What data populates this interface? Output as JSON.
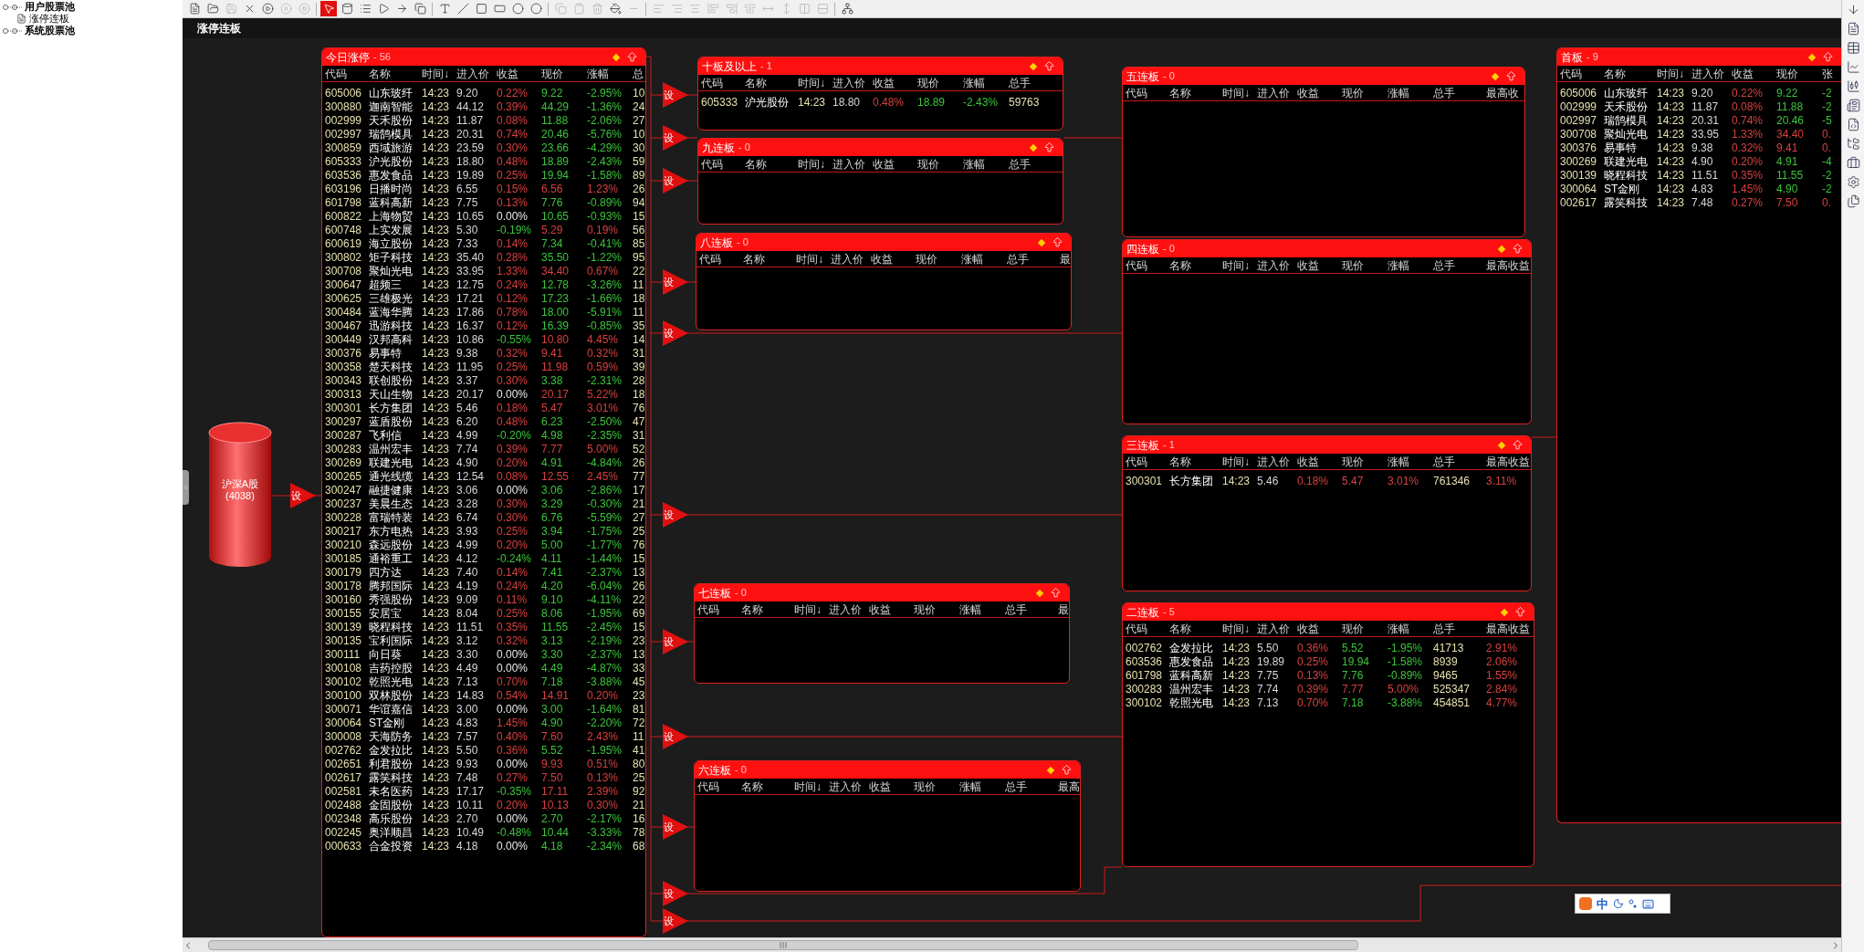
{
  "tree": [
    {
      "label": "用户股票池",
      "children": [
        {
          "label": "涨停连板"
        }
      ]
    },
    {
      "label": "系统股票池"
    }
  ],
  "toolbar_tools": [
    {
      "selected": false,
      "disabled": false
    },
    {
      "selected": false,
      "disabled": false
    },
    {
      "selected": false,
      "disabled": true
    },
    {
      "selected": false,
      "disabled": false
    },
    {
      "selected": false,
      "disabled": false
    },
    {
      "selected": false,
      "disabled": true
    },
    {
      "selected": false,
      "disabled": true
    },
    {
      "selected": true,
      "disabled": false
    },
    {
      "selected": false,
      "disabled": false
    },
    {
      "selected": false,
      "disabled": false
    },
    {
      "selected": false,
      "disabled": false
    },
    {
      "selected": false,
      "disabled": false
    },
    {
      "selected": false,
      "disabled": false
    },
    {
      "selected": false,
      "disabled": false
    },
    {
      "selected": false,
      "disabled": false
    },
    {
      "selected": false,
      "disabled": false
    },
    {
      "selected": false,
      "disabled": false
    },
    {
      "selected": false,
      "disabled": false
    },
    {
      "selected": false,
      "disabled": false
    },
    {
      "selected": false,
      "disabled": true
    },
    {
      "selected": false,
      "disabled": true
    },
    {
      "selected": false,
      "disabled": true
    },
    {
      "selected": false,
      "disabled": false
    },
    {
      "selected": false,
      "disabled": true
    },
    {
      "selected": false,
      "disabled": true
    },
    {
      "selected": false,
      "disabled": true
    },
    {
      "selected": false,
      "disabled": true
    },
    {
      "selected": false,
      "disabled": true
    },
    {
      "selected": false,
      "disabled": true
    },
    {
      "selected": false,
      "disabled": true
    },
    {
      "selected": false,
      "disabled": true
    },
    {
      "selected": false,
      "disabled": true
    },
    {
      "selected": false,
      "disabled": true
    },
    {
      "selected": false,
      "disabled": true
    },
    {
      "selected": false,
      "disabled": false
    }
  ],
  "view_title": "涨停连板",
  "source": {
    "label": "沪深A股",
    "count": "(4038)"
  },
  "markers": [
    "设",
    "设",
    "设",
    "设",
    "设",
    "设",
    "设",
    "设",
    "设",
    "设",
    "设",
    "设"
  ],
  "panels": [
    {
      "title": "今日涨停",
      "count": "- 56",
      "columns": [
        "代码",
        "名称",
        "时间↓",
        "进入价",
        "收益",
        "现价",
        "涨幅",
        "总"
      ],
      "rows": [
        {
          "cells": [
            "605006",
            "山东玻纤",
            "14:23",
            "9.20",
            "0.22%",
            "9.22",
            "-2.95%",
            "10"
          ],
          "color": "#3cc43c"
        },
        {
          "cells": [
            "300880",
            "迦南智能",
            "14:23",
            "44.12",
            "0.39%",
            "44.29",
            "-1.36%",
            "24"
          ],
          "color": "#3cc43c"
        },
        {
          "cells": [
            "002999",
            "天禾股份",
            "14:23",
            "11.87",
            "0.08%",
            "11.88",
            "-2.06%",
            "27"
          ],
          "color": "#3cc43c"
        },
        {
          "cells": [
            "002997",
            "瑞鹄模具",
            "14:23",
            "20.31",
            "0.74%",
            "20.46",
            "-5.76%",
            "10"
          ],
          "color": "#3cc43c"
        },
        {
          "cells": [
            "300859",
            "西域旅游",
            "14:23",
            "23.59",
            "0.30%",
            "23.66",
            "-4.29%",
            "30"
          ],
          "color": "#3cc43c"
        },
        {
          "cells": [
            "605333",
            "沪光股份",
            "14:23",
            "18.80",
            "0.48%",
            "18.89",
            "-2.43%",
            "59"
          ],
          "color": "#3cc43c"
        },
        {
          "cells": [
            "603536",
            "惠发食品",
            "14:23",
            "19.89",
            "0.25%",
            "19.94",
            "-1.58%",
            "89"
          ],
          "color": "#3cc43c"
        },
        {
          "cells": [
            "603196",
            "日播时尚",
            "14:23",
            "6.55",
            "0.15%",
            "6.56",
            "1.23%",
            "26"
          ],
          "color": "#d84040"
        },
        {
          "cells": [
            "601798",
            "蓝科高新",
            "14:23",
            "7.75",
            "0.13%",
            "7.76",
            "-0.89%",
            "94"
          ],
          "color": "#3cc43c"
        },
        {
          "cells": [
            "600822",
            "上海物贸",
            "14:23",
            "10.65",
            "0.00%",
            "10.65",
            "-0.93%",
            "15"
          ],
          "color": "#3cc43c"
        },
        {
          "cells": [
            "600748",
            "上实发展",
            "14:23",
            "5.30",
            "-0.19%",
            "5.29",
            "0.19%",
            "56"
          ],
          "color": "#d84040"
        },
        {
          "cells": [
            "600619",
            "海立股份",
            "14:23",
            "7.33",
            "0.14%",
            "7.34",
            "-0.41%",
            "85"
          ],
          "color": "#3cc43c"
        },
        {
          "cells": [
            "300802",
            "矩子科技",
            "14:23",
            "35.40",
            "0.28%",
            "35.50",
            "-1.22%",
            "95"
          ],
          "color": "#3cc43c"
        },
        {
          "cells": [
            "300708",
            "聚灿光电",
            "14:23",
            "33.95",
            "1.33%",
            "34.40",
            "0.67%",
            "22"
          ],
          "color": "#d84040"
        },
        {
          "cells": [
            "300647",
            "超频三",
            "14:23",
            "12.75",
            "0.24%",
            "12.78",
            "-3.26%",
            "11"
          ],
          "color": "#3cc43c"
        },
        {
          "cells": [
            "300625",
            "三雄极光",
            "14:23",
            "17.21",
            "0.12%",
            "17.23",
            "-1.66%",
            "18"
          ],
          "color": "#3cc43c"
        },
        {
          "cells": [
            "300484",
            "蓝海华腾",
            "14:23",
            "17.86",
            "0.78%",
            "18.00",
            "-5.91%",
            "11"
          ],
          "color": "#3cc43c"
        },
        {
          "cells": [
            "300467",
            "迅游科技",
            "14:23",
            "16.37",
            "0.12%",
            "16.39",
            "-0.85%",
            "35"
          ],
          "color": "#3cc43c"
        },
        {
          "cells": [
            "300449",
            "汉邦高科",
            "14:23",
            "10.86",
            "-0.55%",
            "10.80",
            "4.45%",
            "14"
          ],
          "color": "#d84040"
        },
        {
          "cells": [
            "300376",
            "易事特",
            "14:23",
            "9.38",
            "0.32%",
            "9.41",
            "0.32%",
            "31"
          ],
          "color": "#d84040"
        },
        {
          "cells": [
            "300358",
            "楚天科技",
            "14:23",
            "11.95",
            "0.25%",
            "11.98",
            "0.59%",
            "39"
          ],
          "color": "#d84040"
        },
        {
          "cells": [
            "300343",
            "联创股份",
            "14:23",
            "3.37",
            "0.30%",
            "3.38",
            "-2.31%",
            "28"
          ],
          "color": "#3cc43c"
        },
        {
          "cells": [
            "300313",
            "天山生物",
            "14:23",
            "20.17",
            "0.00%",
            "20.17",
            "5.22%",
            "18"
          ],
          "color": "#d84040"
        },
        {
          "cells": [
            "300301",
            "长方集团",
            "14:23",
            "5.46",
            "0.18%",
            "5.47",
            "3.01%",
            "76"
          ],
          "color": "#d84040"
        },
        {
          "cells": [
            "300297",
            "蓝盾股份",
            "14:23",
            "6.20",
            "0.48%",
            "6.23",
            "-2.50%",
            "47"
          ],
          "color": "#3cc43c"
        },
        {
          "cells": [
            "300287",
            "飞利信",
            "14:23",
            "4.99",
            "-0.20%",
            "4.98",
            "-2.35%",
            "31"
          ],
          "color": "#3cc43c"
        },
        {
          "cells": [
            "300283",
            "温州宏丰",
            "14:23",
            "7.74",
            "0.39%",
            "7.77",
            "5.00%",
            "52"
          ],
          "color": "#d84040"
        },
        {
          "cells": [
            "300269",
            "联建光电",
            "14:23",
            "4.90",
            "0.20%",
            "4.91",
            "-4.84%",
            "26"
          ],
          "color": "#3cc43c"
        },
        {
          "cells": [
            "300265",
            "通光线缆",
            "14:23",
            "12.54",
            "0.08%",
            "12.55",
            "2.45%",
            "77"
          ],
          "color": "#d84040"
        },
        {
          "cells": [
            "300247",
            "融捷健康",
            "14:23",
            "3.06",
            "0.00%",
            "3.06",
            "-2.86%",
            "17"
          ],
          "color": "#3cc43c"
        },
        {
          "cells": [
            "300237",
            "美晨生态",
            "14:23",
            "3.28",
            "0.30%",
            "3.29",
            "-0.30%",
            "21"
          ],
          "color": "#3cc43c"
        },
        {
          "cells": [
            "300228",
            "富瑞特装",
            "14:23",
            "6.74",
            "0.30%",
            "6.76",
            "-5.59%",
            "27"
          ],
          "color": "#3cc43c"
        },
        {
          "cells": [
            "300217",
            "东方电热",
            "14:23",
            "3.93",
            "0.25%",
            "3.94",
            "-1.75%",
            "25"
          ],
          "color": "#3cc43c"
        },
        {
          "cells": [
            "300210",
            "森远股份",
            "14:23",
            "4.99",
            "0.20%",
            "5.00",
            "-1.77%",
            "76"
          ],
          "color": "#3cc43c"
        },
        {
          "cells": [
            "300185",
            "通裕重工",
            "14:23",
            "4.12",
            "-0.24%",
            "4.11",
            "-1.44%",
            "15"
          ],
          "color": "#3cc43c"
        },
        {
          "cells": [
            "300179",
            "四方达",
            "14:23",
            "7.40",
            "0.14%",
            "7.41",
            "-2.37%",
            "13"
          ],
          "color": "#3cc43c"
        },
        {
          "cells": [
            "300178",
            "腾邦国际",
            "14:23",
            "4.19",
            "0.24%",
            "4.20",
            "-6.04%",
            "26"
          ],
          "color": "#3cc43c"
        },
        {
          "cells": [
            "300160",
            "秀强股份",
            "14:23",
            "9.09",
            "0.11%",
            "9.10",
            "-4.11%",
            "22"
          ],
          "color": "#3cc43c"
        },
        {
          "cells": [
            "300155",
            "安居宝",
            "14:23",
            "8.04",
            "0.25%",
            "8.06",
            "-1.95%",
            "69"
          ],
          "color": "#3cc43c"
        },
        {
          "cells": [
            "300139",
            "晓程科技",
            "14:23",
            "11.51",
            "0.35%",
            "11.55",
            "-2.45%",
            "15"
          ],
          "color": "#3cc43c"
        },
        {
          "cells": [
            "300135",
            "宝利国际",
            "14:23",
            "3.12",
            "0.32%",
            "3.13",
            "-2.19%",
            "23"
          ],
          "color": "#3cc43c"
        },
        {
          "cells": [
            "300111",
            "向日葵",
            "14:23",
            "3.30",
            "0.00%",
            "3.30",
            "-2.37%",
            "13"
          ],
          "color": "#3cc43c"
        },
        {
          "cells": [
            "300108",
            "吉药控股",
            "14:23",
            "4.49",
            "0.00%",
            "4.49",
            "-4.87%",
            "33"
          ],
          "color": "#3cc43c"
        },
        {
          "cells": [
            "300102",
            "乾照光电",
            "14:23",
            "7.13",
            "0.70%",
            "7.18",
            "-3.88%",
            "45"
          ],
          "color": "#3cc43c"
        },
        {
          "cells": [
            "300100",
            "双林股份",
            "14:23",
            "14.83",
            "0.54%",
            "14.91",
            "0.20%",
            "23"
          ],
          "color": "#d84040"
        },
        {
          "cells": [
            "300071",
            "华谊嘉信",
            "14:23",
            "3.00",
            "0.00%",
            "3.00",
            "-1.64%",
            "81"
          ],
          "color": "#3cc43c"
        },
        {
          "cells": [
            "300064",
            "ST金刚",
            "14:23",
            "4.83",
            "1.45%",
            "4.90",
            "-2.20%",
            "72"
          ],
          "color": "#3cc43c"
        },
        {
          "cells": [
            "300008",
            "天海防务",
            "14:23",
            "7.57",
            "0.40%",
            "7.60",
            "2.43%",
            "11"
          ],
          "color": "#d84040"
        },
        {
          "cells": [
            "002762",
            "金发拉比",
            "14:23",
            "5.50",
            "0.36%",
            "5.52",
            "-1.95%",
            "41"
          ],
          "color": "#3cc43c"
        },
        {
          "cells": [
            "002651",
            "利君股份",
            "14:23",
            "9.93",
            "0.00%",
            "9.93",
            "0.51%",
            "80"
          ],
          "color": "#d84040"
        },
        {
          "cells": [
            "002617",
            "露笑科技",
            "14:23",
            "7.48",
            "0.27%",
            "7.50",
            "0.13%",
            "25"
          ],
          "color": "#d84040"
        },
        {
          "cells": [
            "002581",
            "未名医药",
            "14:23",
            "17.17",
            "-0.35%",
            "17.11",
            "2.39%",
            "92"
          ],
          "color": "#d84040"
        },
        {
          "cells": [
            "002488",
            "金固股份",
            "14:23",
            "10.11",
            "0.20%",
            "10.13",
            "0.30%",
            "21"
          ],
          "color": "#d84040"
        },
        {
          "cells": [
            "002348",
            "高乐股份",
            "14:23",
            "2.70",
            "0.00%",
            "2.70",
            "-2.17%",
            "16"
          ],
          "color": "#3cc43c"
        },
        {
          "cells": [
            "002245",
            "奥洋顺昌",
            "14:23",
            "10.49",
            "-0.48%",
            "10.44",
            "-3.33%",
            "78"
          ],
          "color": "#3cc43c"
        },
        {
          "cells": [
            "000633",
            "合金投资",
            "14:23",
            "4.18",
            "0.00%",
            "4.18",
            "-2.34%",
            "68"
          ],
          "color": "#3cc43c"
        }
      ]
    },
    {
      "title": "十板及以上",
      "count": "- 1",
      "columns": [
        "代码",
        "名称",
        "时间↓",
        "进入价",
        "收益",
        "现价",
        "涨幅",
        "总手"
      ],
      "rows": [
        {
          "cells": [
            "605333",
            "沪光股份",
            "14:23",
            "18.80",
            "0.48%",
            "18.89",
            "-2.43%",
            "59763"
          ],
          "color": "#3cc43c"
        }
      ]
    },
    {
      "title": "九连板",
      "count": "- 0",
      "columns": [
        "代码",
        "名称",
        "时间↓",
        "进入价",
        "收益",
        "现价",
        "涨幅",
        "总手"
      ]
    },
    {
      "title": "八连板",
      "count": "- 0",
      "columns": [
        "代码",
        "名称",
        "时间↓",
        "进入价",
        "收益",
        "现价",
        "涨幅",
        "总手",
        "最"
      ]
    },
    {
      "title": "七连板",
      "count": "- 0",
      "columns": [
        "代码",
        "名称",
        "时间↓",
        "进入价",
        "收益",
        "现价",
        "涨幅",
        "总手",
        "最"
      ]
    },
    {
      "title": "六连板",
      "count": "- 0",
      "columns": [
        "代码",
        "名称",
        "时间↓",
        "进入价",
        "收益",
        "现价",
        "涨幅",
        "总手",
        "最高"
      ]
    },
    {
      "title": "五连板",
      "count": "- 0",
      "columns": [
        "代码",
        "名称",
        "时间↓",
        "进入价",
        "收益",
        "现价",
        "涨幅",
        "总手",
        "最高收"
      ]
    },
    {
      "title": "四连板",
      "count": "- 0",
      "columns": [
        "代码",
        "名称",
        "时间↓",
        "进入价",
        "收益",
        "现价",
        "涨幅",
        "总手",
        "最高收益"
      ]
    },
    {
      "title": "三连板",
      "count": "- 1",
      "columns": [
        "代码",
        "名称",
        "时间↓",
        "进入价",
        "收益",
        "现价",
        "涨幅",
        "总手",
        "最高收益"
      ],
      "rows": [
        {
          "cells": [
            "300301",
            "长方集团",
            "14:23",
            "5.46",
            "0.18%",
            "5.47",
            "3.01%",
            "761346",
            "3.11%"
          ],
          "color": "#d84040"
        }
      ]
    },
    {
      "title": "二连板",
      "count": "- 5",
      "columns": [
        "代码",
        "名称",
        "时间↓",
        "进入价",
        "收益",
        "现价",
        "涨幅",
        "总手",
        "最高收益"
      ],
      "rows": [
        {
          "cells": [
            "002762",
            "金发拉比",
            "14:23",
            "5.50",
            "0.36%",
            "5.52",
            "-1.95%",
            "41713",
            "2.91%"
          ],
          "color": "#3cc43c"
        },
        {
          "cells": [
            "603536",
            "惠发食品",
            "14:23",
            "19.89",
            "0.25%",
            "19.94",
            "-1.58%",
            "8939",
            "2.06%"
          ],
          "color": "#3cc43c"
        },
        {
          "cells": [
            "601798",
            "蓝科高新",
            "14:23",
            "7.75",
            "0.13%",
            "7.76",
            "-0.89%",
            "9465",
            "1.55%"
          ],
          "color": "#3cc43c"
        },
        {
          "cells": [
            "300283",
            "温州宏丰",
            "14:23",
            "7.74",
            "0.39%",
            "7.77",
            "5.00%",
            "525347",
            "2.84%"
          ],
          "color": "#d84040"
        },
        {
          "cells": [
            "300102",
            "乾照光电",
            "14:23",
            "7.13",
            "0.70%",
            "7.18",
            "-3.88%",
            "454851",
            "4.77%"
          ],
          "color": "#3cc43c"
        }
      ]
    },
    {
      "title": "首板",
      "count": "- 9",
      "columns": [
        "代码",
        "名称",
        "时间↓",
        "进入价",
        "收益",
        "现价",
        "张"
      ],
      "rows": [
        {
          "cells": [
            "605006",
            "山东玻纤",
            "14:23",
            "9.20",
            "0.22%",
            "9.22",
            "-2"
          ],
          "color": "#3cc43c"
        },
        {
          "cells": [
            "002999",
            "天禾股份",
            "14:23",
            "11.87",
            "0.08%",
            "11.88",
            "-2"
          ],
          "color": "#3cc43c"
        },
        {
          "cells": [
            "002997",
            "瑞鹄模具",
            "14:23",
            "20.31",
            "0.74%",
            "20.46",
            "-5"
          ],
          "color": "#3cc43c"
        },
        {
          "cells": [
            "300708",
            "聚灿光电",
            "14:23",
            "33.95",
            "1.33%",
            "34.40",
            "0."
          ],
          "color": "#d84040"
        },
        {
          "cells": [
            "300376",
            "易事特",
            "14:23",
            "9.38",
            "0.32%",
            "9.41",
            "0."
          ],
          "color": "#d84040"
        },
        {
          "cells": [
            "300269",
            "联建光电",
            "14:23",
            "4.90",
            "0.20%",
            "4.91",
            "-4"
          ],
          "color": "#3cc43c"
        },
        {
          "cells": [
            "300139",
            "晓程科技",
            "14:23",
            "11.51",
            "0.35%",
            "11.55",
            "-2"
          ],
          "color": "#3cc43c"
        },
        {
          "cells": [
            "300064",
            "ST金刚",
            "14:23",
            "4.83",
            "1.45%",
            "4.90",
            "-2"
          ],
          "color": "#3cc43c"
        },
        {
          "cells": [
            "002617",
            "露笑科技",
            "14:23",
            "7.48",
            "0.27%",
            "7.50",
            "0."
          ],
          "color": "#d84040"
        }
      ]
    }
  ],
  "ime_bar": {
    "mode": "中"
  }
}
